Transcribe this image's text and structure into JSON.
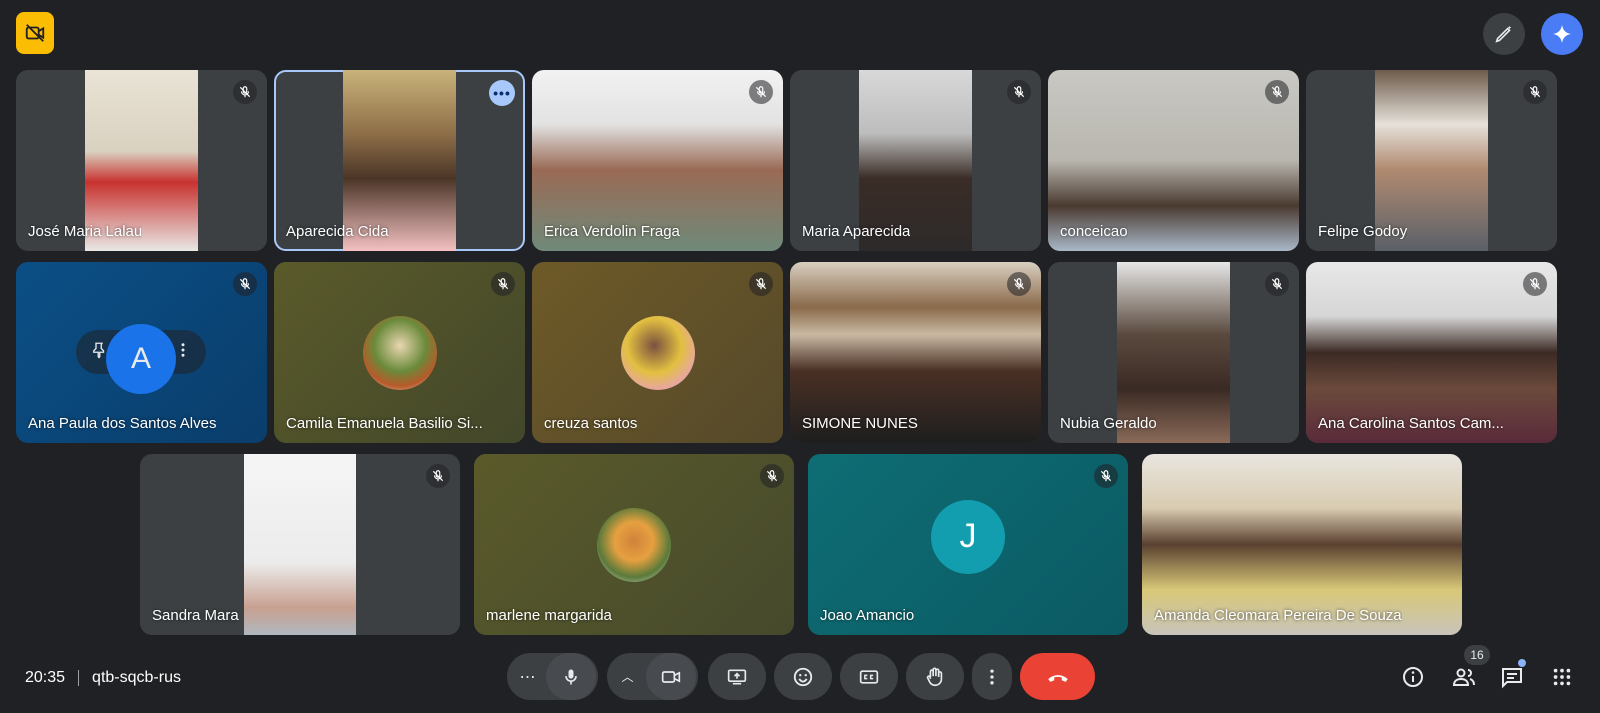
{
  "meeting": {
    "time": "20:35",
    "code": "qtb-sqcb-rus",
    "participant_count": "16"
  },
  "participants": [
    {
      "name": "José Maria Lalau",
      "muted": true,
      "type": "video"
    },
    {
      "name": "Aparecida Cida",
      "muted": false,
      "type": "video",
      "selected": true
    },
    {
      "name": "Erica Verdolin Fraga",
      "muted": true,
      "type": "video"
    },
    {
      "name": "Maria Aparecida",
      "muted": true,
      "type": "video"
    },
    {
      "name": "conceicao",
      "muted": true,
      "type": "video"
    },
    {
      "name": "Felipe Godoy",
      "muted": true,
      "type": "video"
    },
    {
      "name": "Ana Paula dos Santos Alves",
      "muted": true,
      "type": "avatar-pinned"
    },
    {
      "name": "Camila Emanuela Basilio Si...",
      "muted": true,
      "type": "avatar"
    },
    {
      "name": "creuza santos",
      "muted": true,
      "type": "avatar"
    },
    {
      "name": "SIMONE NUNES",
      "muted": true,
      "type": "video"
    },
    {
      "name": "Nubia Geraldo",
      "muted": true,
      "type": "video"
    },
    {
      "name": "Ana Carolina Santos Cam...",
      "muted": true,
      "type": "video"
    },
    {
      "name": "Sandra Mara",
      "muted": true,
      "type": "video"
    },
    {
      "name": "marlene margarida",
      "muted": true,
      "type": "avatar"
    },
    {
      "name": "Joao Amancio",
      "muted": true,
      "type": "letter",
      "letter": "J"
    },
    {
      "name": "Amanda Cleomara Pereira De Souza",
      "muted": false,
      "type": "video"
    }
  ],
  "pinned_avatar_letter": "A",
  "more_label": "•••",
  "icons": {
    "top_left": "no-video-icon",
    "edit": "pen-sparkle-icon",
    "gemini": "gemini-icon",
    "mic": "microphone-icon",
    "camera": "camera-icon",
    "present": "present-screen-icon",
    "emoji": "emoji-icon",
    "captions": "captions-icon",
    "raise_hand": "raise-hand-icon",
    "more": "more-vert-icon",
    "hangup": "hangup-icon",
    "info": "info-icon",
    "people": "people-icon",
    "chat": "chat-icon",
    "activities": "apps-grid-icon"
  },
  "colors": {
    "background": "#202124",
    "tile": "#3c4043",
    "selected_outline": "#a8c7fa",
    "hangup": "#ea4335",
    "brand_yellow": "#fbbc04"
  }
}
